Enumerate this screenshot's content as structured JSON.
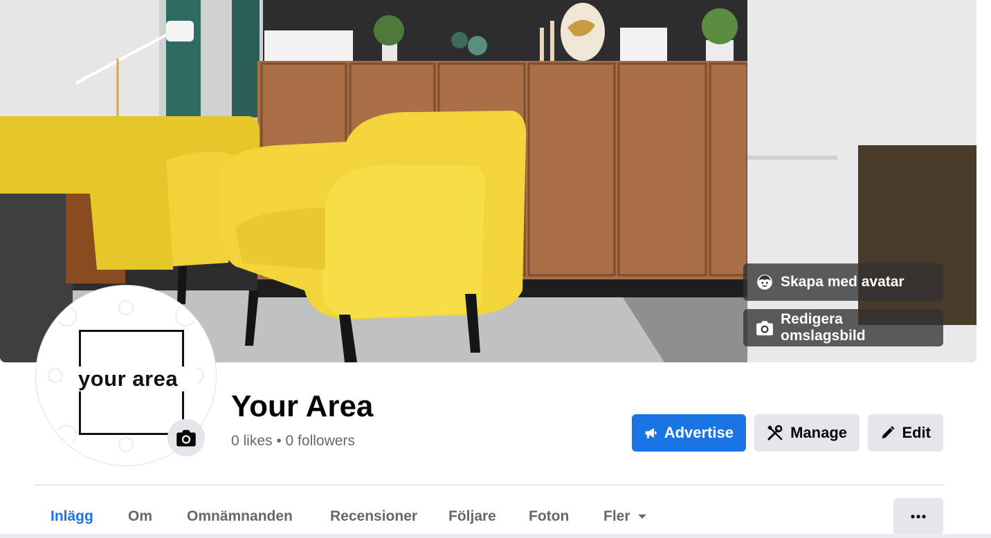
{
  "cover": {
    "avatar_button_label": "Skapa med avatar",
    "edit_cover_label": "Redigera omslagsbild"
  },
  "profile": {
    "logo_text": "your area",
    "name": "Your Area",
    "stats": "0 likes • 0 followers"
  },
  "actions": {
    "advertise_label": "Advertise",
    "manage_label": "Manage",
    "edit_label": "Edit"
  },
  "tabs": [
    {
      "label": "Inlägg",
      "active": true
    },
    {
      "label": "Om"
    },
    {
      "label": "Omnämnanden"
    },
    {
      "label": "Recensioner"
    },
    {
      "label": "Följare"
    },
    {
      "label": "Foton"
    },
    {
      "label": "Fler"
    }
  ],
  "colors": {
    "accent": "#1b74e4",
    "secondary_button": "#e4e6eb",
    "muted_text": "#65676b"
  },
  "icons": [
    "avatar-face-icon",
    "camera-icon",
    "megaphone-icon",
    "tools-icon",
    "pencil-icon",
    "caret-down-icon",
    "more-dots-icon"
  ]
}
